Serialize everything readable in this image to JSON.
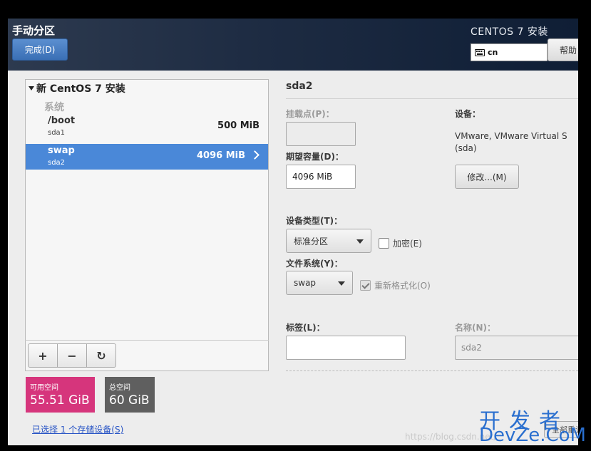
{
  "header": {
    "title": "手动分区",
    "done_button": "完成(D)",
    "product": "CENTOS 7 安装",
    "keyboard_layout": "cn",
    "help_button": "帮助"
  },
  "tree": {
    "root_label": "新 CentOS 7 安装",
    "group_label": "系统",
    "partitions": [
      {
        "mount": "/boot",
        "device": "sda1",
        "size": "500 MiB"
      },
      {
        "mount": "swap",
        "device": "sda2",
        "size": "4096 MiB"
      }
    ]
  },
  "toolbar": {
    "add": "+",
    "remove": "−",
    "reload": "↻"
  },
  "space": {
    "available_label": "可用空间",
    "available_value": "55.51 GiB",
    "total_label": "总空间",
    "total_value": "60 GiB"
  },
  "storage_link": "已选择 1 个存储设备(S)",
  "details": {
    "title": "sda2",
    "mount_label": "挂载点(P)：",
    "mount_value": "",
    "capacity_label": "期望容量(D)：",
    "capacity_value": "4096 MiB",
    "device_label": "设备：",
    "device_text": "VMware, VMware Virtual S (sda)",
    "modify_button": "修改...(M)",
    "device_type_label": "设备类型(T)：",
    "device_type_value": "标准分区",
    "encrypt_label": "加密(E)",
    "fs_label": "文件系统(Y)：",
    "fs_value": "swap",
    "reformat_label": "重新格式化(O)",
    "tag_label": "标签(L)：",
    "tag_value": "",
    "name_label": "名称(N)：",
    "name_value": "sda2",
    "reset_button": "全部重设"
  },
  "watermark": {
    "cn": "开发者",
    "en": "DevZe.CoM",
    "url": "https://blog.csdn.net/"
  }
}
